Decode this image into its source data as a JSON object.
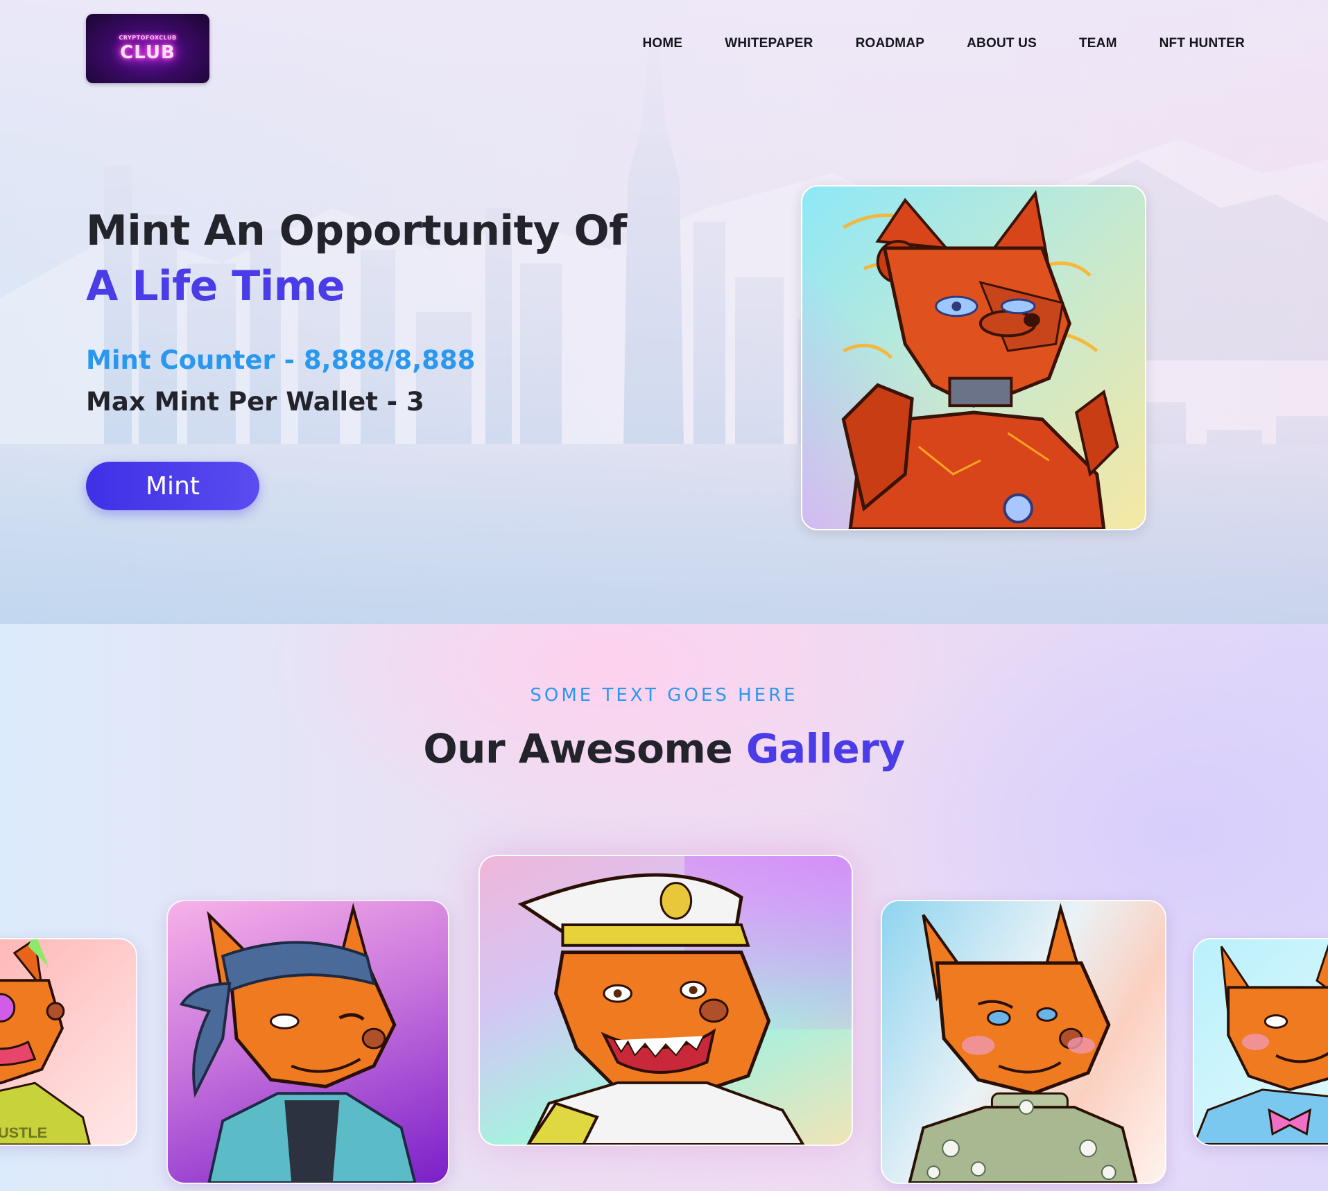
{
  "logo": {
    "line1": "CRYPTOFOXCLUB",
    "line2": "CLUB"
  },
  "nav": {
    "items": [
      "HOME",
      "WHITEPAPER",
      "ROADMAP",
      "ABOUT US",
      "TEAM",
      "NFT HUNTER"
    ]
  },
  "hero": {
    "title_line1": "Mint An Opportunity Of",
    "title_line2": "A Life Time",
    "mint_counter": "Mint Counter - 8,888/8,888",
    "max_mint": "Max Mint Per Wallet - 3",
    "mint_button": "Mint"
  },
  "gallery": {
    "eyebrow": "SOME TEXT GOES HERE",
    "title_main": "Our Awesome ",
    "title_accent": "Gallery",
    "card1_shirt_text": "HUSTLE"
  },
  "colors": {
    "accent_purple": "#4a3ce6",
    "accent_blue": "#2a98ee",
    "text_dark": "#23232b"
  }
}
